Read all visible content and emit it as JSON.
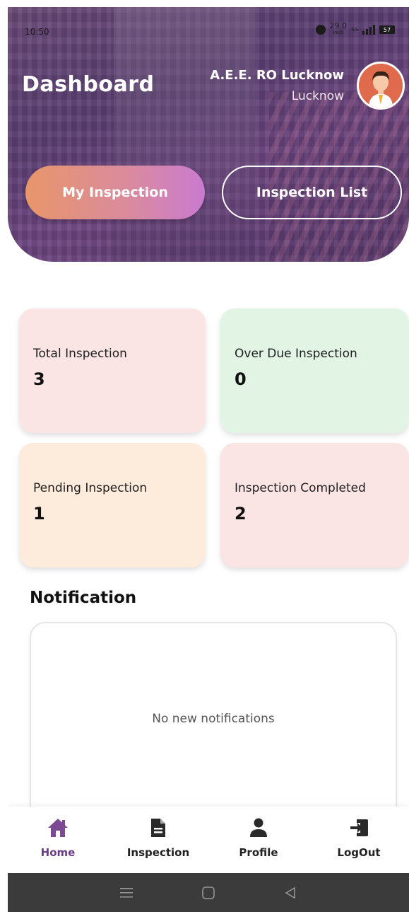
{
  "status_bar": {
    "time": "10:50",
    "speed": "29.0",
    "speed_unit": "KB/S",
    "network": "5G",
    "battery": "57"
  },
  "header": {
    "title": "Dashboard",
    "user_name": "A.E.E. RO Lucknow",
    "user_location": "Lucknow",
    "avatar_icon": "user-avatar-icon",
    "gradient_colors": [
      "#6a4a78",
      "#5b3f73"
    ]
  },
  "actions": {
    "my_inspection": "My Inspection",
    "inspection_list": "Inspection List"
  },
  "stats": [
    {
      "label": "Total Inspection",
      "value": "3",
      "color": "#fbe5e4"
    },
    {
      "label": "Over Due Inspection",
      "value": "0",
      "color": "#e2f5e5"
    },
    {
      "label": "Pending Inspection",
      "value": "1",
      "color": "#fdebdb"
    },
    {
      "label": "Inspection Completed",
      "value": "2",
      "color": "#fbe5e4"
    }
  ],
  "notifications": {
    "title": "Notification",
    "empty_text": "No new notifications"
  },
  "bottom_nav": {
    "active": "Home",
    "accent": "#6a3d86",
    "items": [
      {
        "label": "Home",
        "icon": "home-icon"
      },
      {
        "label": "Inspection",
        "icon": "document-icon"
      },
      {
        "label": "Profile",
        "icon": "person-icon"
      },
      {
        "label": "LogOut",
        "icon": "logout-icon"
      }
    ]
  }
}
